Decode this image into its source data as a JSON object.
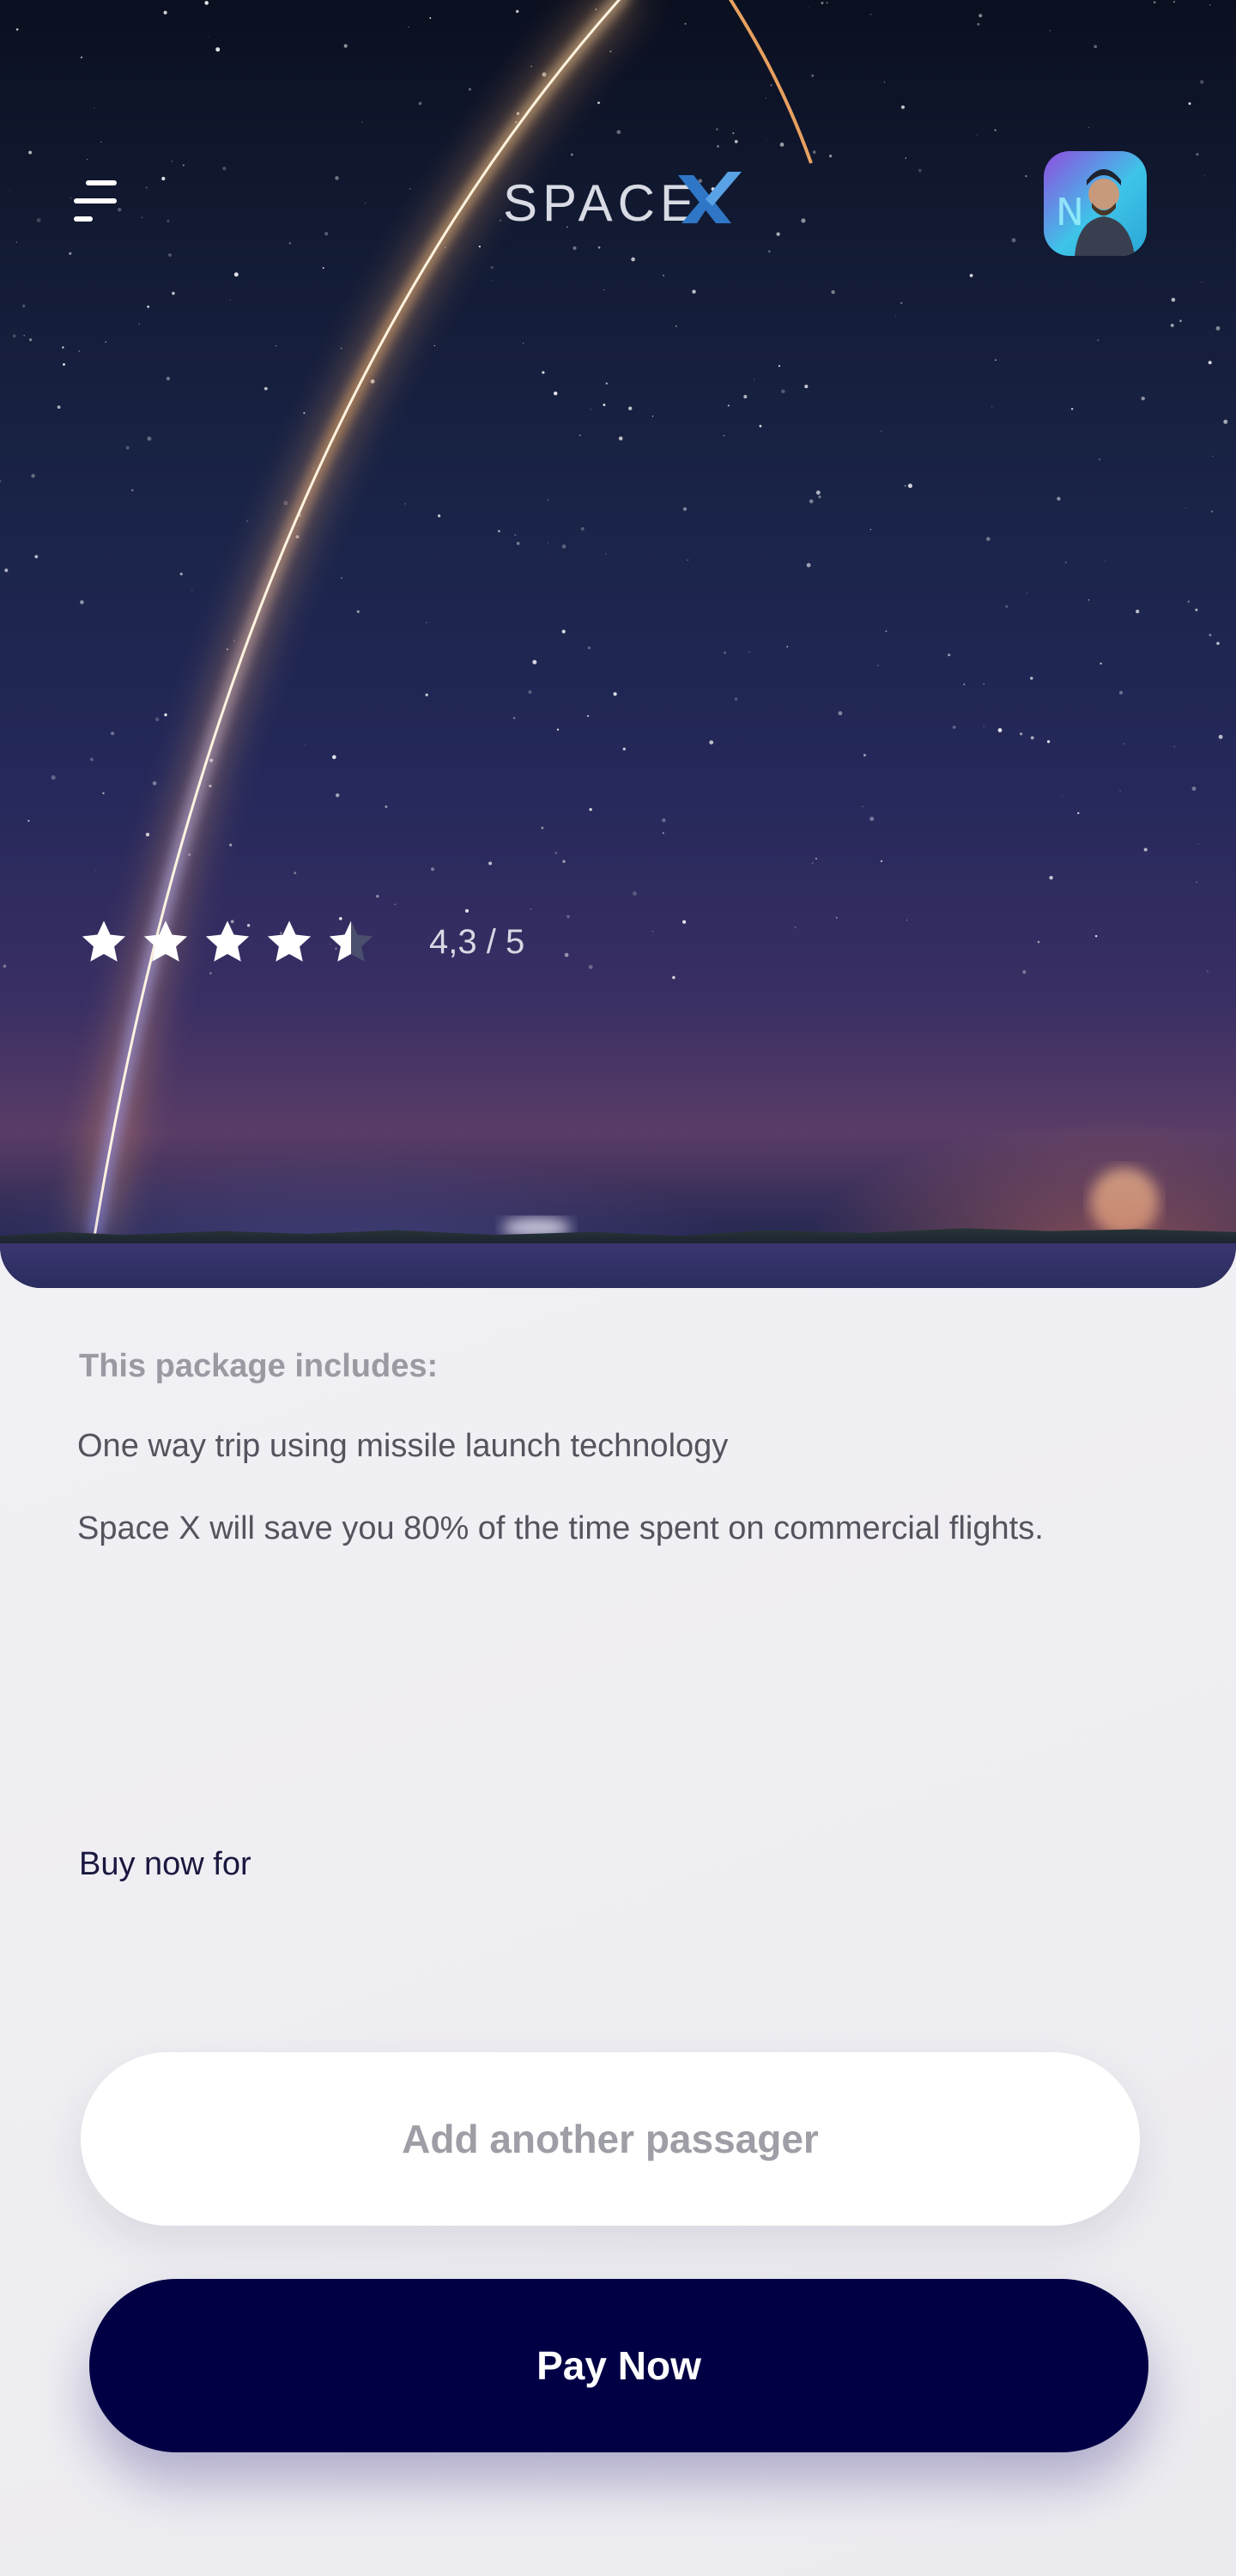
{
  "header": {
    "menu_icon": "menu-icon",
    "logo_text": "SPACE",
    "logo_mark": "X",
    "avatar_icon": "user-avatar"
  },
  "hero": {
    "rating": {
      "value": 4.3,
      "max": 5,
      "label": "4,3 / 5"
    }
  },
  "package": {
    "title": "This package includes:",
    "items": [
      "One way trip using missile launch technology",
      "Space X will save you 80% of the time spent on commercial flights."
    ]
  },
  "purchase": {
    "buy_label": "Buy now for"
  },
  "actions": {
    "add_passenger_label": "Add another passager",
    "pay_label": "Pay Now"
  },
  "colors": {
    "primary_button": "#020045",
    "secondary_button": "#ffffff",
    "muted_text": "#9b9aa3",
    "body_text": "#55545e"
  }
}
